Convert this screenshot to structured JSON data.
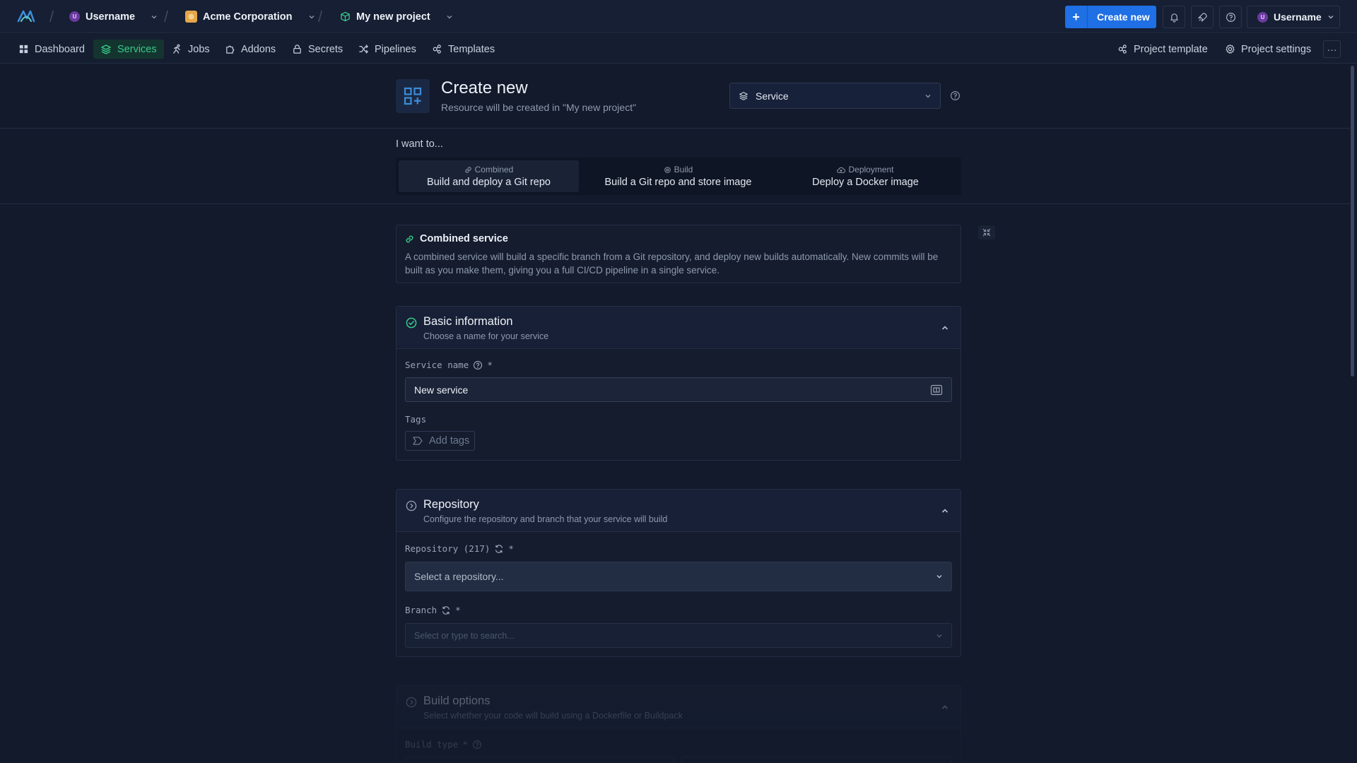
{
  "topbar": {
    "breadcrumbs": [
      {
        "label": "Username",
        "avatar_initial": "U"
      },
      {
        "label": "Acme Corporation"
      },
      {
        "label": "My new project"
      }
    ],
    "create_new_label": "Create new",
    "user_menu": {
      "label": "Username",
      "avatar_initial": "U"
    }
  },
  "nav": {
    "items": [
      {
        "label": "Dashboard",
        "icon": "dashboard-icon",
        "active": false
      },
      {
        "label": "Services",
        "icon": "layers-icon",
        "active": true
      },
      {
        "label": "Jobs",
        "icon": "runner-icon",
        "active": false
      },
      {
        "label": "Addons",
        "icon": "puzzle-icon",
        "active": false
      },
      {
        "label": "Secrets",
        "icon": "lock-icon",
        "active": false
      },
      {
        "label": "Pipelines",
        "icon": "shuffle-icon",
        "active": false
      },
      {
        "label": "Templates",
        "icon": "template-icon",
        "active": false
      }
    ],
    "right": {
      "project_template": "Project template",
      "project_settings": "Project settings",
      "more": "···"
    }
  },
  "header": {
    "title": "Create new",
    "subtitle": "Resource will be created in \"My new project\"",
    "type_select": "Service"
  },
  "intent": {
    "label": "I want to...",
    "options": [
      {
        "small": "Combined",
        "big": "Build and deploy a Git repo",
        "active": true
      },
      {
        "small": "Build",
        "big": "Build a Git repo and store image",
        "active": false
      },
      {
        "small": "Deployment",
        "big": "Deploy a Docker image",
        "active": false
      }
    ]
  },
  "info": {
    "title": "Combined service",
    "text": "A combined service will build a specific branch from a Git repository, and deploy new builds automatically. New commits will be built as you make them, giving you a full CI/CD pipeline in a single service."
  },
  "basic": {
    "title": "Basic information",
    "subtitle": "Choose a name for your service",
    "service_name_label": "Service name",
    "service_name_value": "New service",
    "tags_label": "Tags",
    "add_tags": "Add tags"
  },
  "repository": {
    "title": "Repository",
    "subtitle": "Configure the repository and branch that your service will build",
    "repo_label": "Repository (217)",
    "repo_placeholder": "Select a repository...",
    "branch_label": "Branch",
    "branch_placeholder": "Select or type to search..."
  },
  "build": {
    "title": "Build options",
    "subtitle": "Select whether your code will build using a Dockerfile or Buildpack",
    "build_type_label": "Build type"
  },
  "colors": {
    "accent_blue": "#1f6fe5",
    "accent_green": "#38c98a",
    "background": "#121a2b"
  }
}
